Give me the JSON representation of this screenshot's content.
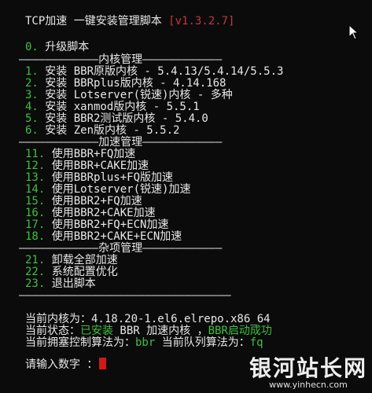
{
  "header": {
    "title": "TCP加速 一键安装管理脚本",
    "version": "[v1.3.2.7]"
  },
  "upgrade": {
    "num": "0.",
    "label": " 升级脚本"
  },
  "sections": {
    "kernel": "————————————内核管理————————————",
    "accel": "————————————加速管理————————————",
    "misc": "————————————杂项管理————————————",
    "end": "————————————————————————————————"
  },
  "kernel_items": [
    {
      "num": "1.",
      "label": " 安装 BBR原版内核 - 5.4.13/5.4.14/5.5.3"
    },
    {
      "num": "2.",
      "label": " 安装 BBRplus版内核 - 4.14.168"
    },
    {
      "num": "3.",
      "label": " 安装 Lotserver(锐速)内核 - 多种"
    },
    {
      "num": "4.",
      "label": " 安装 xanmod版内核 - 5.5.1"
    },
    {
      "num": "5.",
      "label": " 安装 BBR2测试版内核 - 5.4.0"
    },
    {
      "num": "6.",
      "label": " 安装 Zen版内核 - 5.5.2"
    }
  ],
  "accel_items": [
    {
      "num": "11.",
      "label": " 使用BBR+FQ加速"
    },
    {
      "num": "12.",
      "label": " 使用BBR+CAKE加速"
    },
    {
      "num": "13.",
      "label": " 使用BBRplus+FQ版加速"
    },
    {
      "num": "14.",
      "label": " 使用Lotserver(锐速)加速"
    },
    {
      "num": "15.",
      "label": " 使用BBR2+FQ加速"
    },
    {
      "num": "16.",
      "label": " 使用BBR2+CAKE加速"
    },
    {
      "num": "17.",
      "label": " 使用BBR2+FQ+ECN加速"
    },
    {
      "num": "18.",
      "label": " 使用BBR2+CAKE+ECN加速"
    }
  ],
  "misc_items": [
    {
      "num": "21.",
      "label": " 卸载全部加速"
    },
    {
      "num": "22.",
      "label": " 系统配置优化"
    },
    {
      "num": "23.",
      "label": " 退出脚本"
    }
  ],
  "status": {
    "kernel_label": "当前内核为：",
    "kernel_value": "4.18.20-1.el6.elrepo.x86_64",
    "state_label": "当前状态：",
    "state_installed": "已安装",
    "state_bbr": " BBR 加速内核 ",
    "state_sep": "，",
    "state_started": "BBR启动成功",
    "cc_label": "当前拥塞控制算法为：",
    "cc_value": "bbr",
    "queue_label": " 当前队列算法为：",
    "queue_value": "fq"
  },
  "prompt": {
    "label": "请输入数字 ："
  },
  "watermark": {
    "cn": "银河站长网",
    "url": "www.yinhecn.com"
  }
}
